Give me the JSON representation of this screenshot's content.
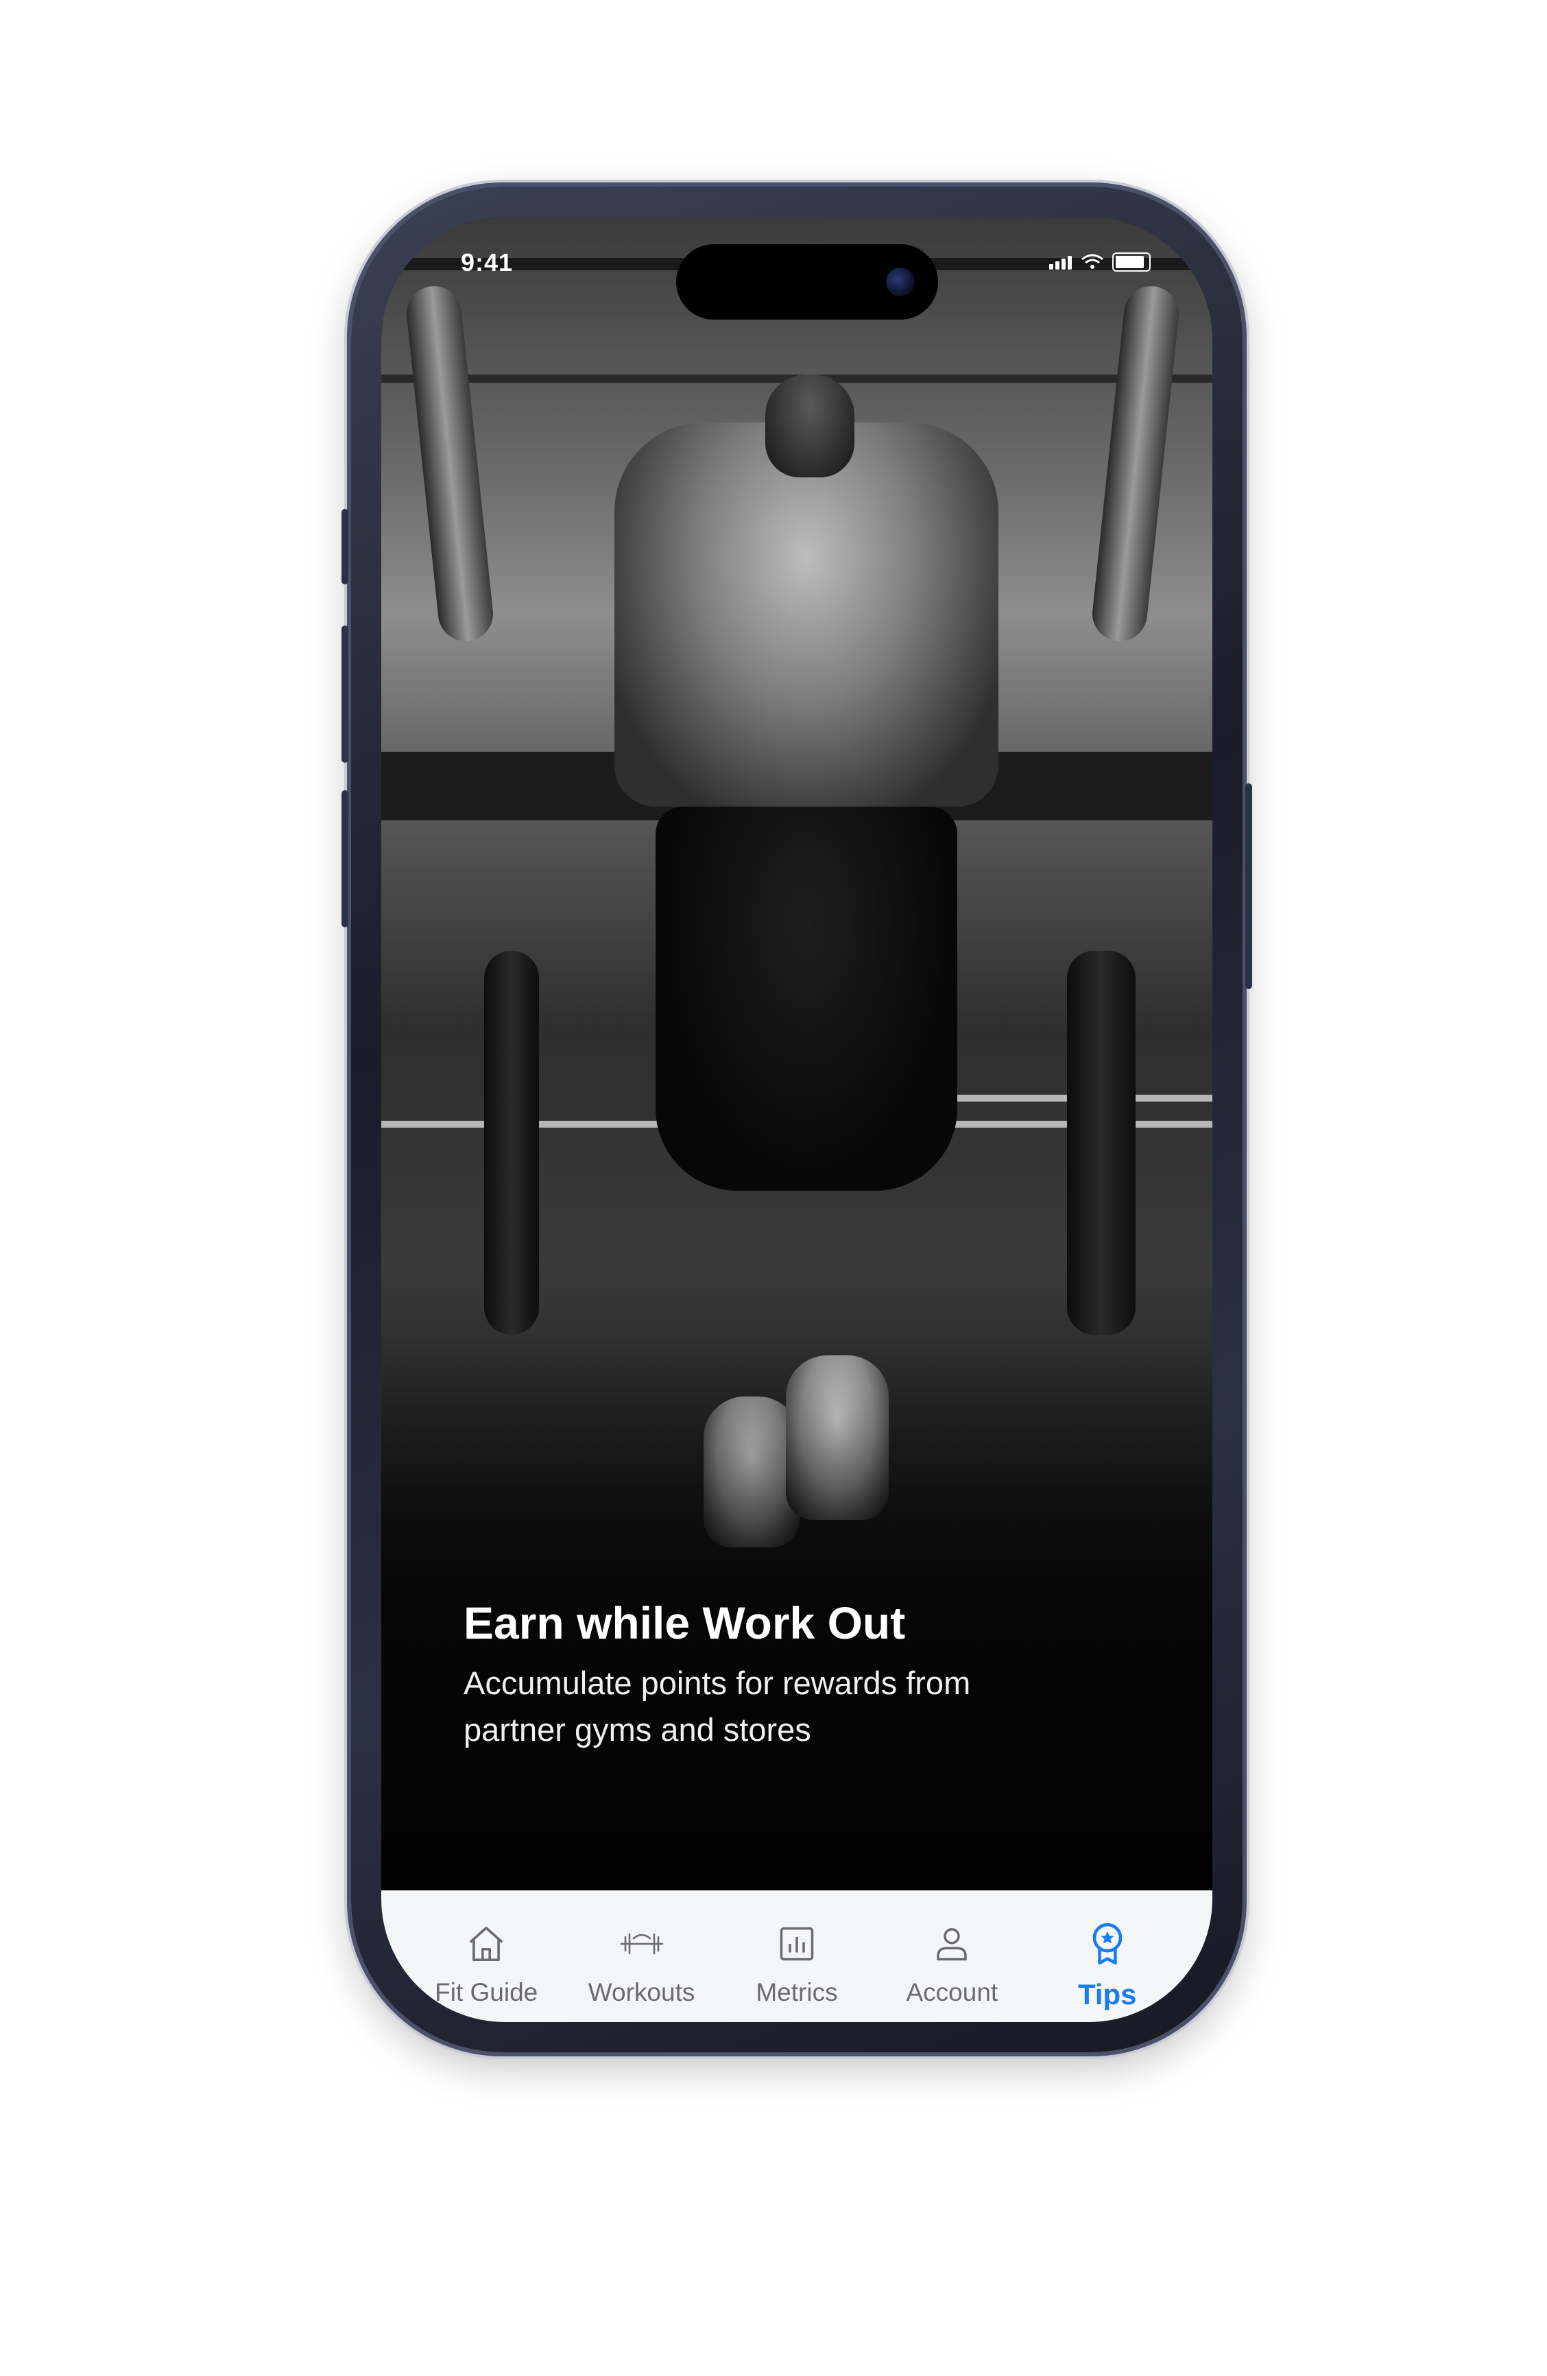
{
  "status_bar": {
    "time": "9:41"
  },
  "hero": {
    "title": "Earn while Work Out",
    "subtitle": "Accumulate points for rewards from partner gyms and stores"
  },
  "tab_bar": {
    "active": "Tips",
    "accent_color": "#1a7bf2",
    "items": [
      {
        "label": "Fit Guide",
        "icon": "home-icon"
      },
      {
        "label": "Workouts",
        "icon": "dumbbell-icon"
      },
      {
        "label": "Metrics",
        "icon": "bar-chart-icon"
      },
      {
        "label": "Account",
        "icon": "user-icon"
      },
      {
        "label": "Tips",
        "icon": "award-badge-icon"
      }
    ]
  }
}
